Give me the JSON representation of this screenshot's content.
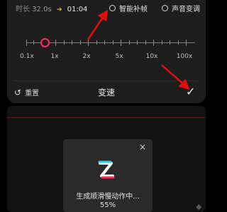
{
  "duration": {
    "label": "时长",
    "original": "32.0s",
    "new": "01:04"
  },
  "options": {
    "smart_frame": "智能补帧",
    "voice_change": "声音变调"
  },
  "speed": {
    "ticks": [
      "0.1x",
      "1x",
      "2x",
      "5x",
      "10x",
      "100x"
    ],
    "current": "1x"
  },
  "footer": {
    "reset_label": "重置",
    "title": "变速",
    "confirm_glyph": "✓"
  },
  "modal": {
    "close_glyph": "×",
    "status": "生成顺滑慢动作中...",
    "progress_text": "55%",
    "progress": 0.55
  },
  "corner_glyph": "◆",
  "colors": {
    "accent": "#ff2f5a",
    "highlight": "#e6c800",
    "annotation_arrow": "#e01010",
    "logo_cyan": "#22d3ee"
  }
}
